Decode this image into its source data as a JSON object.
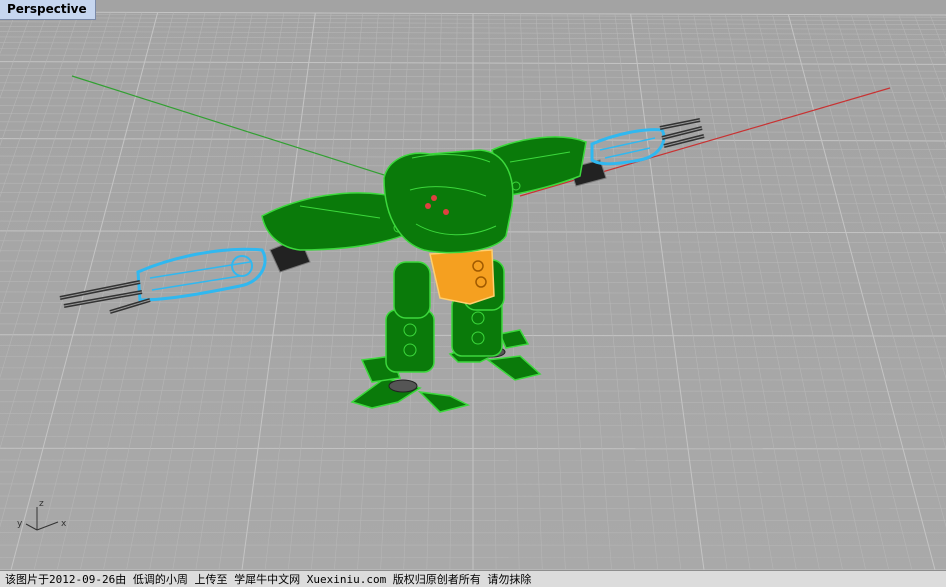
{
  "viewport": {
    "title": "Perspective"
  },
  "axis_widget": {
    "x_label": "x",
    "y_label": "y",
    "z_label": "z"
  },
  "world_axes": {
    "x_axis_color": "#c83232",
    "y_axis_color": "#32a032"
  },
  "model": {
    "body_color": "#0a7a0a",
    "highlight_color": "#3cd83c",
    "arm_color": "#30b8f0",
    "pelvis_color": "#f5a020"
  },
  "status_bar": {
    "text": "该图片于2012-09-26由 低调的小周 上传至 学犀牛中文网 Xuexiniu.com 版权归原创者所有 请勿抹除"
  }
}
